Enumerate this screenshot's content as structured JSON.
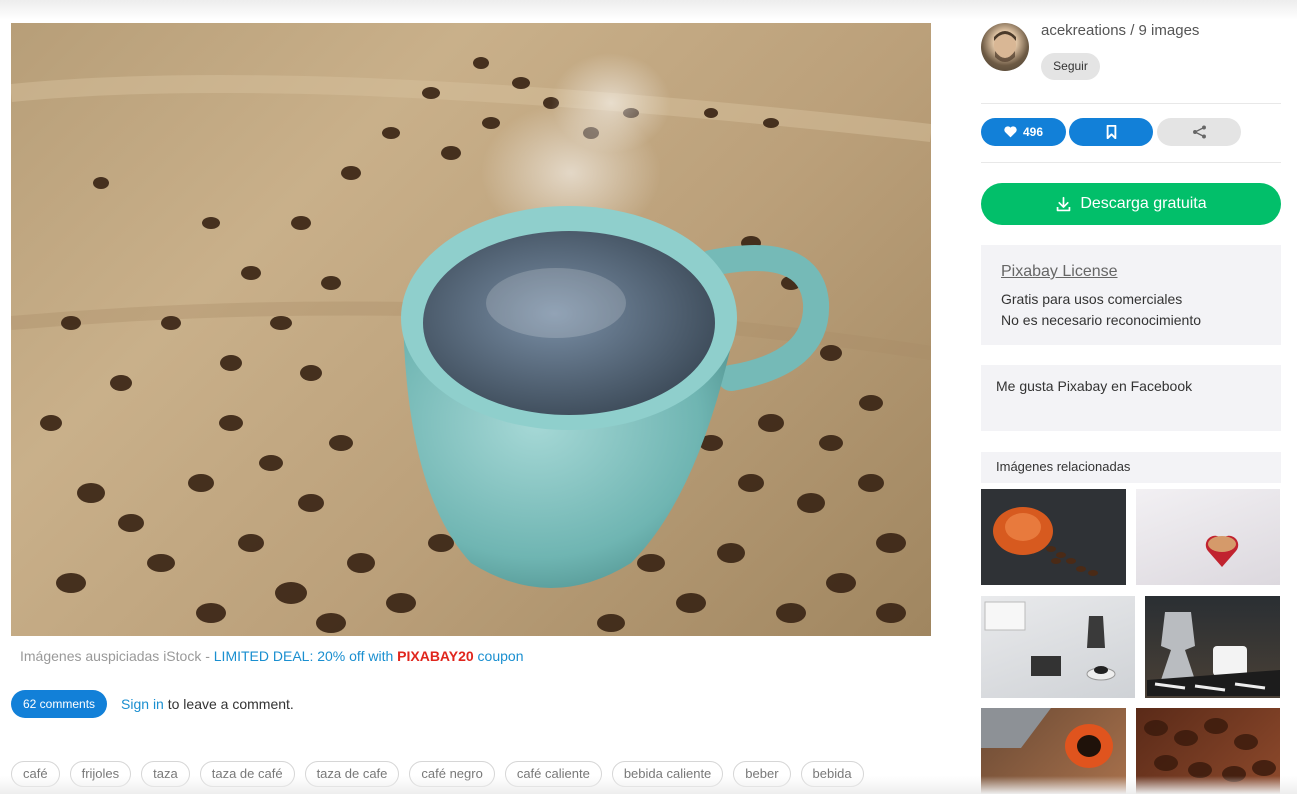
{
  "user": {
    "name_line": "acekreations / 9 images",
    "follow_label": "Seguir"
  },
  "actions": {
    "like_count": "496",
    "like_icon": "heart-icon",
    "save_icon": "bookmark-icon",
    "share_icon": "share-icon"
  },
  "download": {
    "label": "Descarga gratuita",
    "icon": "download-icon"
  },
  "license": {
    "title": "Pixabay License",
    "line1": "Gratis para usos comerciales",
    "line2": "No es necesario reconocimiento"
  },
  "facebook": {
    "text": "Me gusta Pixabay en Facebook"
  },
  "related": {
    "heading": "Imágenes relacionadas"
  },
  "sponsor": {
    "prefix": "Imágenes auspiciadas iStock - ",
    "deal": "LIMITED DEAL: 20% off with ",
    "code": "PIXABAY20",
    "suffix": " coupon"
  },
  "comments": {
    "button": "62 comments",
    "signin": "Sign in",
    "rest": " to leave a comment."
  },
  "tags": [
    "café",
    "frijoles",
    "taza",
    "taza de café",
    "taza de cafe",
    "café negro",
    "café caliente",
    "bebida caliente",
    "beber",
    "bebida"
  ],
  "colors": {
    "primary_blue": "#1280d8",
    "download_green": "#02bf6a",
    "coupon_red": "#e0261d"
  }
}
